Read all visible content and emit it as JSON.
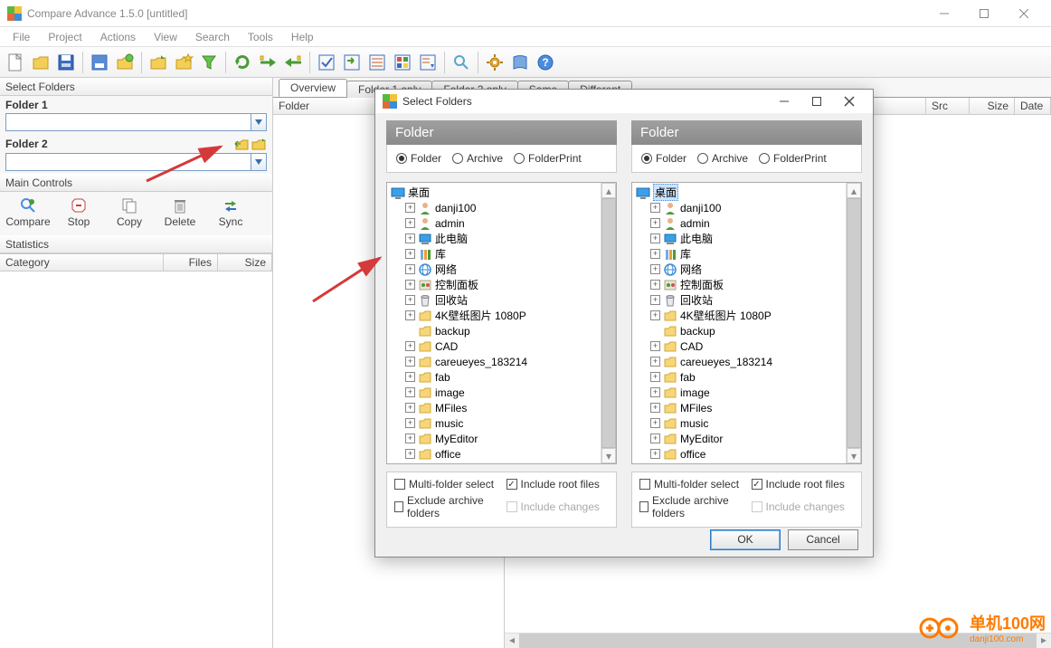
{
  "window": {
    "title": "Compare Advance 1.5.0 [untitled]"
  },
  "menu": [
    "File",
    "Project",
    "Actions",
    "View",
    "Search",
    "Tools",
    "Help"
  ],
  "left": {
    "section_select": "Select Folders",
    "folder1": "Folder 1",
    "folder2": "Folder 2",
    "main_controls_title": "Main Controls",
    "controls": [
      "Compare",
      "Stop",
      "Copy",
      "Delete",
      "Sync"
    ],
    "statistics_title": "Statistics",
    "stat_headers": [
      "Category",
      "Files",
      "Size"
    ]
  },
  "tabs": [
    "Overview",
    "Folder 1 only",
    "Folder 2 only",
    "Same",
    "Different"
  ],
  "grid": {
    "folder_header": "Folder",
    "cols_right": [
      "Src",
      "Size",
      "Date"
    ]
  },
  "dialog": {
    "title": "Select Folders",
    "panel_header": "Folder",
    "radios": [
      "Folder",
      "Archive",
      "FolderPrint"
    ],
    "tree": [
      {
        "label": "桌面",
        "icon": "desktop",
        "exp": "",
        "root": true
      },
      {
        "label": "danji100",
        "icon": "user",
        "exp": "+",
        "ind": 1
      },
      {
        "label": "admin",
        "icon": "user",
        "exp": "+",
        "ind": 1
      },
      {
        "label": "此电脑",
        "icon": "pc",
        "exp": "+",
        "ind": 1
      },
      {
        "label": "库",
        "icon": "lib",
        "exp": "+",
        "ind": 1
      },
      {
        "label": "网络",
        "icon": "net",
        "exp": "+",
        "ind": 1
      },
      {
        "label": "控制面板",
        "icon": "ctrl",
        "exp": "+",
        "ind": 1
      },
      {
        "label": "回收站",
        "icon": "bin",
        "exp": "+",
        "ind": 1
      },
      {
        "label": "4K壁纸图片 1080P",
        "icon": "folder",
        "exp": "+",
        "ind": 1
      },
      {
        "label": "backup",
        "icon": "folder",
        "exp": "",
        "ind": 1
      },
      {
        "label": "CAD",
        "icon": "folder",
        "exp": "+",
        "ind": 1
      },
      {
        "label": "careueyes_183214",
        "icon": "folder",
        "exp": "+",
        "ind": 1
      },
      {
        "label": "fab",
        "icon": "folder",
        "exp": "+",
        "ind": 1
      },
      {
        "label": "image",
        "icon": "folder",
        "exp": "+",
        "ind": 1
      },
      {
        "label": "MFiles",
        "icon": "folder",
        "exp": "+",
        "ind": 1
      },
      {
        "label": "music",
        "icon": "folder",
        "exp": "+",
        "ind": 1
      },
      {
        "label": "MyEditor",
        "icon": "folder",
        "exp": "+",
        "ind": 1
      },
      {
        "label": "office",
        "icon": "folder",
        "exp": "+",
        "ind": 1
      }
    ],
    "checks": {
      "multi": "Multi-folder select",
      "root": "Include root files",
      "excl": "Exclude archive folders",
      "ichg": "Include changes"
    },
    "ok": "OK",
    "cancel": "Cancel"
  },
  "watermark": {
    "name": "单机100网",
    "url": "danji100.com"
  }
}
